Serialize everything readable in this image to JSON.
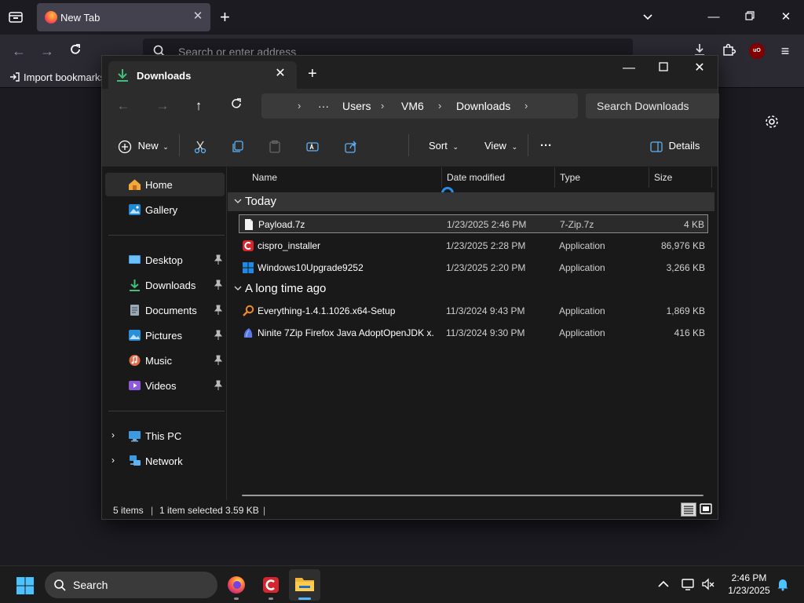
{
  "browser": {
    "tab": {
      "title": "New Tab"
    },
    "urlbar": {
      "placeholder": "Search or enter address"
    },
    "bookmarks": {
      "import_label": "Import bookmarks"
    },
    "ublock_label": "uO"
  },
  "explorer": {
    "tab": {
      "title": "Downloads"
    },
    "breadcrumb": [
      "Users",
      "VM6",
      "Downloads"
    ],
    "breadcrumb_more": "···",
    "search_placeholder": "Search Downloads",
    "commands": {
      "new": "New",
      "sort": "Sort",
      "view": "View",
      "more": "···",
      "details": "Details"
    },
    "nav_pane": {
      "home": "Home",
      "gallery": "Gallery",
      "desktop": "Desktop",
      "downloads": "Downloads",
      "documents": "Documents",
      "pictures": "Pictures",
      "music": "Music",
      "videos": "Videos",
      "this_pc": "This PC",
      "network": "Network"
    },
    "columns": {
      "name": "Name",
      "date": "Date modified",
      "type": "Type",
      "size": "Size"
    },
    "groups": [
      {
        "label": "Today",
        "files": [
          {
            "name": "Payload.7z",
            "date": "1/23/2025 2:46 PM",
            "type": "7-Zip.7z",
            "size": "4 KB",
            "icon": "blank-file-icon"
          },
          {
            "name": "cispro_installer",
            "date": "1/23/2025 2:28 PM",
            "type": "Application",
            "size": "86,976 KB",
            "icon": "comodo-icon"
          },
          {
            "name": "Windows10Upgrade9252",
            "date": "1/23/2025 2:20 PM",
            "type": "Application",
            "size": "3,266 KB",
            "icon": "windows-logo-icon"
          }
        ]
      },
      {
        "label": "A long time ago",
        "files": [
          {
            "name": "Everything-1.4.1.1026.x64-Setup",
            "date": "11/3/2024 9:43 PM",
            "type": "Application",
            "size": "1,869 KB",
            "icon": "magnifier-icon"
          },
          {
            "name": "Ninite 7Zip Firefox Java AdoptOpenJDK x...",
            "date": "11/3/2024 9:30 PM",
            "type": "Application",
            "size": "416 KB",
            "icon": "ninite-icon"
          }
        ]
      }
    ],
    "status": {
      "items": "5 items",
      "selected": "1 item selected  3.59 KB"
    }
  },
  "taskbar": {
    "search": "Search",
    "time": "2:46 PM",
    "date": "1/23/2025"
  }
}
